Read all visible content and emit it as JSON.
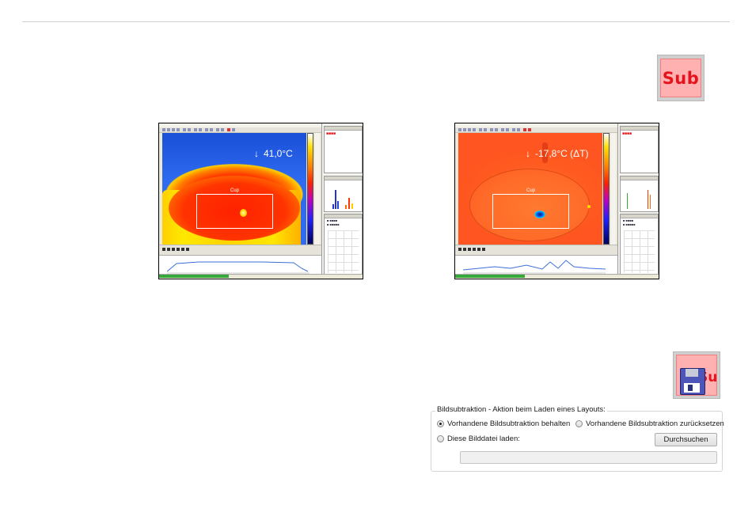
{
  "icons": {
    "subtraction": {
      "name": "subtraction-icon",
      "text": "Sub"
    },
    "save_subtraction": {
      "name": "save-subtraction-icon",
      "text": "Sub"
    }
  },
  "screenshots": {
    "left": {
      "roi_label": "Cup",
      "temperature": "41,0°C",
      "arrow": "↓"
    },
    "right": {
      "roi_label": "Cup",
      "temperature": "-17,8°C (ΔT)",
      "arrow": "↓"
    }
  },
  "dialog": {
    "group_title": "Bildsubtraktion - Aktion beim Laden eines Layouts:",
    "options": [
      {
        "label": "Vorhandene Bildsubtraktion behalten",
        "selected": true
      },
      {
        "label": "Vorhandene Bildsubtraktion zurücksetzen",
        "selected": false
      },
      {
        "label": "Diese Bilddatei laden:",
        "selected": false
      }
    ],
    "browse_label": "Durchsuchen",
    "file_path_value": ""
  },
  "colors": {
    "icon_red": "#e4141e",
    "icon_pink": "#ffb0b0",
    "cold_blue": "#2f6cf0",
    "hot_red": "#ff2a00"
  }
}
